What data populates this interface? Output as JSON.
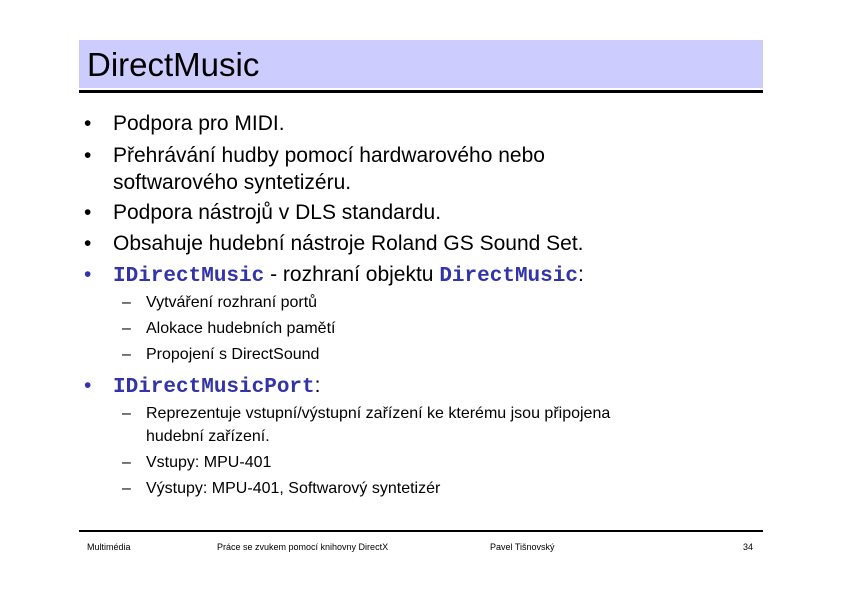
{
  "slide": {
    "title": "DirectMusic",
    "bullets": [
      {
        "text": "Podpora pro MIDI."
      },
      {
        "line1": "Přehrávání hudby pomocí hardwarového nebo",
        "line2": "softwarového syntetizéru."
      },
      {
        "text": "Podpora nástrojů v DLS standardu."
      },
      {
        "text": "Obsahuje hudební nástroje Roland GS Sound Set."
      },
      {
        "code": "IDirectMusic",
        "middle": " - rozhraní objektu ",
        "code2": "DirectMusic",
        "suffix": ":",
        "subitems": [
          "Vytváření rozhraní portů",
          "Alokace hudebních pamětí",
          "Propojení s DirectSound"
        ]
      },
      {
        "code": "IDirectMusicPort",
        "suffix": ":",
        "subitems": [
          {
            "line1": "Reprezentuje vstupní/výstupní zařízení ke kterému jsou připojena",
            "line2": "hudební zařízení."
          },
          "Vstupy: MPU-401",
          "Výstupy: MPU-401, Softwarový syntetizér"
        ]
      }
    ],
    "bullet_glyph": "•",
    "dash_glyph": "–"
  },
  "footer": {
    "left": "Multimédia",
    "center": "Práce se zvukem pomocí knihovny DirectX",
    "author": "Pavel Tišnovský",
    "page": "34"
  },
  "colors": {
    "title_bar": "#ccccff",
    "code_text": "#3333aa"
  }
}
